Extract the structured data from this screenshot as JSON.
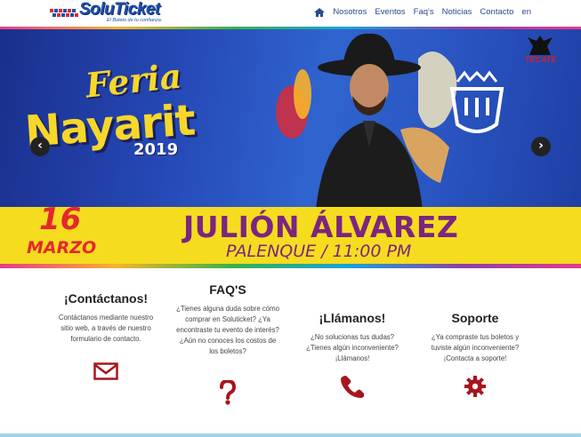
{
  "brand": {
    "name": "SoluTicket",
    "tagline": "El Boleto de tu confianza."
  },
  "nav": {
    "home_icon": "home-icon",
    "items": [
      "Nosotros",
      "Eventos",
      "Faq's",
      "Noticias",
      "Contacto",
      "en"
    ]
  },
  "hero": {
    "feria": "Feria",
    "nayarit": "Nayarit",
    "year": "2019",
    "sponsor": "TECATE",
    "date_day": "16",
    "date_month": "MARZO",
    "artist": "JULIÓN ÁLVAREZ",
    "venue": "PALENQUE / 11:00 PM",
    "prev_arrow": "‹",
    "next_arrow": "›"
  },
  "cards": [
    {
      "title": "¡Contáctanos!",
      "text": "Contáctanos mediante nuestro sitio web, a través de nuestro formulario de contacto.",
      "icon": "envelope-icon"
    },
    {
      "title": "FAQ'S",
      "text": "¿Tienes alguna duda sobre cómo comprar en Soluticket? ¿Ya encontraste tu evento de interés? ¿Aún no conoces los costos de los boletos?",
      "icon": "question-icon"
    },
    {
      "title": "¡Llámanos!",
      "text": "¿No solucionas tus dudas? ¿Tienes algún inconveniente? ¡Llámanos!",
      "icon": "phone-icon"
    },
    {
      "title": "Soporte",
      "text": "¿Ya compraste tus boletos y tuviste algún inconveniente? ¡Contacta a soporte!",
      "icon": "gear-icon"
    }
  ],
  "colors": {
    "nav_text": "#2b4a8f",
    "icon_red": "#a8151c",
    "banner_yellow": "#f5dc1e",
    "artist_purple": "#7b2580"
  }
}
